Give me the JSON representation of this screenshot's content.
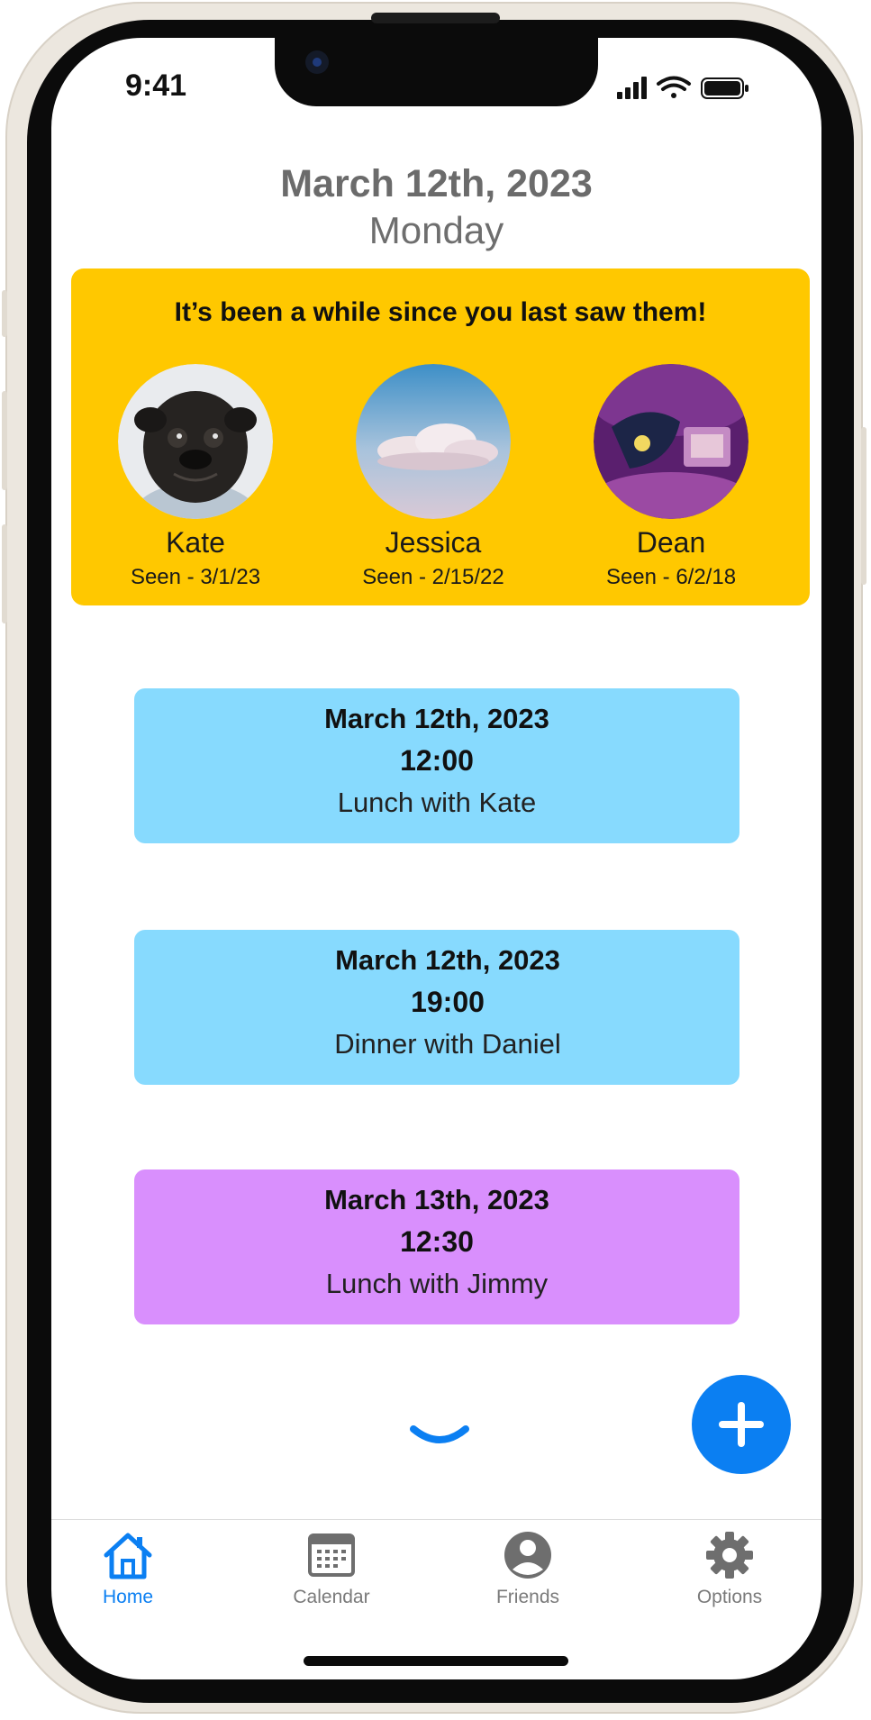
{
  "status_bar": {
    "time": "9:41"
  },
  "header": {
    "date": "March 12th, 2023",
    "weekday": "Monday"
  },
  "reminder": {
    "title": "It’s been a while since you last saw them!",
    "friends": [
      {
        "name": "Kate",
        "seen": "Seen - 3/1/23",
        "avatar": "pug-photo"
      },
      {
        "name": "Jessica",
        "seen": "Seen - 2/15/22",
        "avatar": "cloud-photo"
      },
      {
        "name": "Dean",
        "seen": "Seen - 6/2/18",
        "avatar": "purple-art-photo"
      }
    ]
  },
  "events": [
    {
      "date": "March 12th, 2023",
      "time": "12:00",
      "title": "Lunch with Kate",
      "color": "#87dafe"
    },
    {
      "date": "March 12th, 2023",
      "time": "19:00",
      "title": "Dinner with Daniel",
      "color": "#87dafe"
    },
    {
      "date": "March 13th, 2023",
      "time": "12:30",
      "title": "Lunch with Jimmy",
      "color": "#d98ffd"
    }
  ],
  "tabs": [
    {
      "label": "Home",
      "icon": "home-icon",
      "active": true
    },
    {
      "label": "Calendar",
      "icon": "calendar-icon",
      "active": false
    },
    {
      "label": "Friends",
      "icon": "person-icon",
      "active": false
    },
    {
      "label": "Options",
      "icon": "gear-icon",
      "active": false
    }
  ],
  "colors": {
    "accent": "#0b7ff2",
    "banner": "#ffc800",
    "inactive": "#6e6e6e"
  }
}
